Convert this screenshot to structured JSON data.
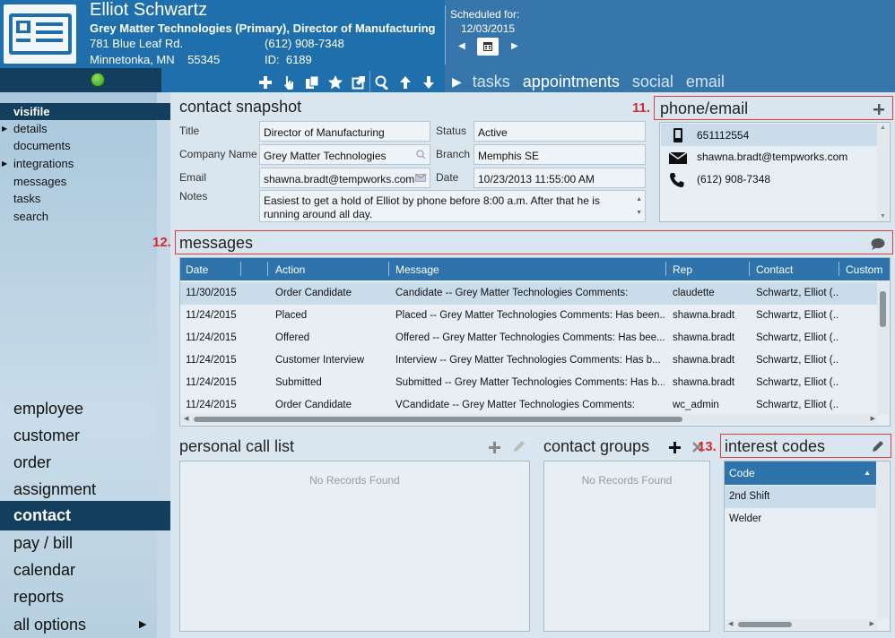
{
  "header": {
    "name": "Elliot Schwartz",
    "company_line": "Grey Matter Technologies (Primary), Director of Manufacturing",
    "address1": "781 Blue Leaf Rd.",
    "address2": "Minnetonka, MN    55345",
    "phone": "(612) 908-7348",
    "id_line": "ID:  6189",
    "status_color": "#3cab22"
  },
  "schedule": {
    "label": "Scheduled for:",
    "date": "12/03/2015"
  },
  "tabs": {
    "tasks": "tasks",
    "appointments": "appointments",
    "social": "social",
    "email": "email"
  },
  "sidebar": {
    "sub_items": [
      "visifile",
      "details",
      "documents",
      "integrations",
      "messages",
      "tasks",
      "search"
    ],
    "nav_items": [
      "employee",
      "customer",
      "order",
      "assignment",
      "contact",
      "pay / bill",
      "calendar",
      "reports",
      "all options"
    ]
  },
  "snapshot": {
    "title": "contact snapshot",
    "labels": {
      "title": "Title",
      "company": "Company Name",
      "email": "Email",
      "notes": "Notes",
      "status": "Status",
      "branch": "Branch",
      "date": "Date"
    },
    "values": {
      "title": "Director of Manufacturing",
      "company": "Grey Matter Technologies",
      "email": "shawna.bradt@tempworks.com",
      "notes": "Easiest to get a hold of Elliot by phone before 8:00 a.m. After that he is running around all day.",
      "status": "Active",
      "branch": "Memphis SE",
      "date": "10/23/2013 11:55:00 AM"
    }
  },
  "phone_email": {
    "num": "11.",
    "title": "phone/email",
    "rows": [
      "651112554",
      "shawna.bradt@tempworks.com",
      "(612) 908-7348"
    ]
  },
  "messages": {
    "num": "12.",
    "title": "messages",
    "columns": [
      "Date",
      "Action",
      "Message",
      "Rep",
      "Contact",
      "Custom"
    ],
    "rows": [
      [
        "11/30/2015",
        "Order Candidate",
        "Candidate  --  Grey Matter Technologies    Comments:",
        "claudette",
        "Schwartz, Elliot (..."
      ],
      [
        "11/24/2015",
        "Placed",
        "Placed  --  Grey Matter Technologies    Comments: Has been...",
        "shawna.bradt",
        "Schwartz, Elliot (..."
      ],
      [
        "11/24/2015",
        "Offered",
        "Offered  --  Grey Matter Technologies    Comments: Has bee...",
        "shawna.bradt",
        "Schwartz, Elliot (..."
      ],
      [
        "11/24/2015",
        "Customer Interview",
        "Interview  --  Grey Matter Technologies    Comments: Has b...",
        "shawna.bradt",
        "Schwartz, Elliot (..."
      ],
      [
        "11/24/2015",
        "Submitted",
        "Submitted  --  Grey Matter Technologies    Comments: Has b...",
        "shawna.bradt",
        "Schwartz, Elliot (..."
      ],
      [
        "11/24/2015",
        "Order Candidate",
        "VCandidate  --  Grey Matter Technologies    Comments:",
        "wc_admin",
        "Schwartz, Elliot (..."
      ]
    ]
  },
  "call_list": {
    "title": "personal call list",
    "empty": "No Records Found"
  },
  "contact_groups": {
    "title": "contact groups",
    "empty": "No Records Found"
  },
  "interest_codes": {
    "num": "13.",
    "title": "interest codes",
    "column": "Code",
    "rows": [
      "2nd Shift",
      "Welder"
    ]
  }
}
